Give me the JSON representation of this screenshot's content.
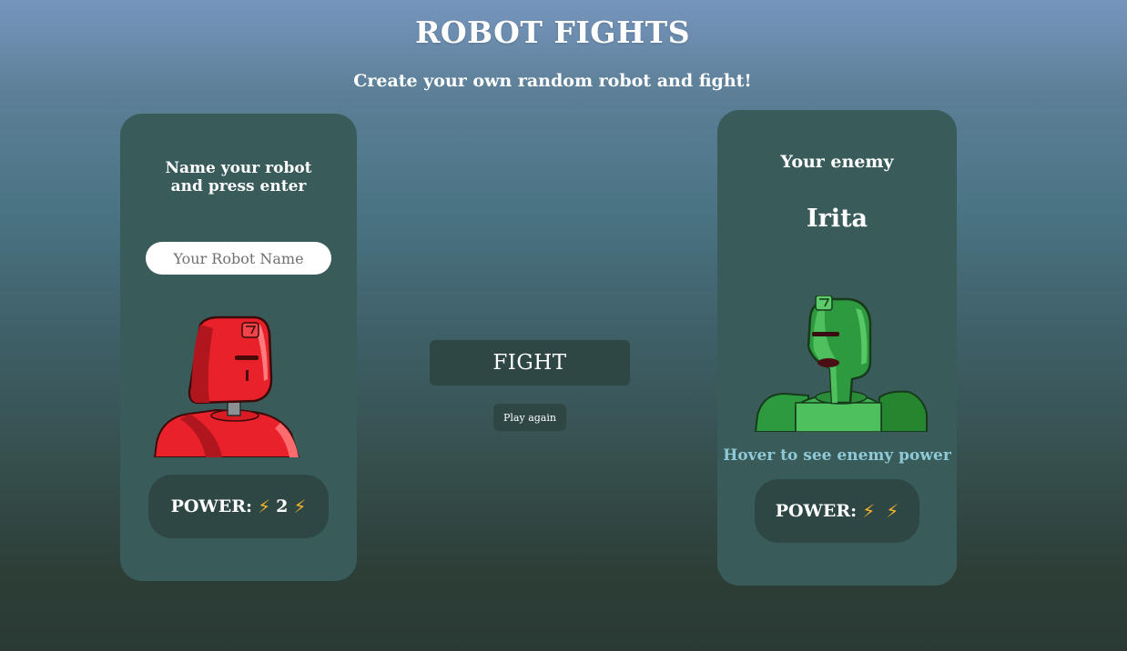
{
  "header": {
    "title": "ROBOT FIGHTS",
    "subtitle": "Create your own random robot and fight!"
  },
  "player_card": {
    "heading": "Name your robot and press enter",
    "name_input": {
      "value": "",
      "placeholder": "Your Robot Name"
    },
    "robot_image": "red-robot",
    "power": {
      "label": "POWER:",
      "value": "2",
      "icon": "lightning-bolt"
    }
  },
  "controls": {
    "fight_label": "FIGHT",
    "play_again_label": "Play again"
  },
  "enemy_card": {
    "heading": "Your enemy",
    "name": "Irita",
    "robot_image": "green-robot",
    "hover_hint": "Hover to see enemy power",
    "power": {
      "label": "POWER:",
      "value": "",
      "icon": "lightning-bolt"
    }
  },
  "colors": {
    "card_background": "#395c5b",
    "button_background": "#2e4744",
    "hover_hint": "#8fc9d5",
    "bolt": "#f2b32a",
    "player_robot": "#e8212a",
    "enemy_robot": "#2e9a3f"
  }
}
